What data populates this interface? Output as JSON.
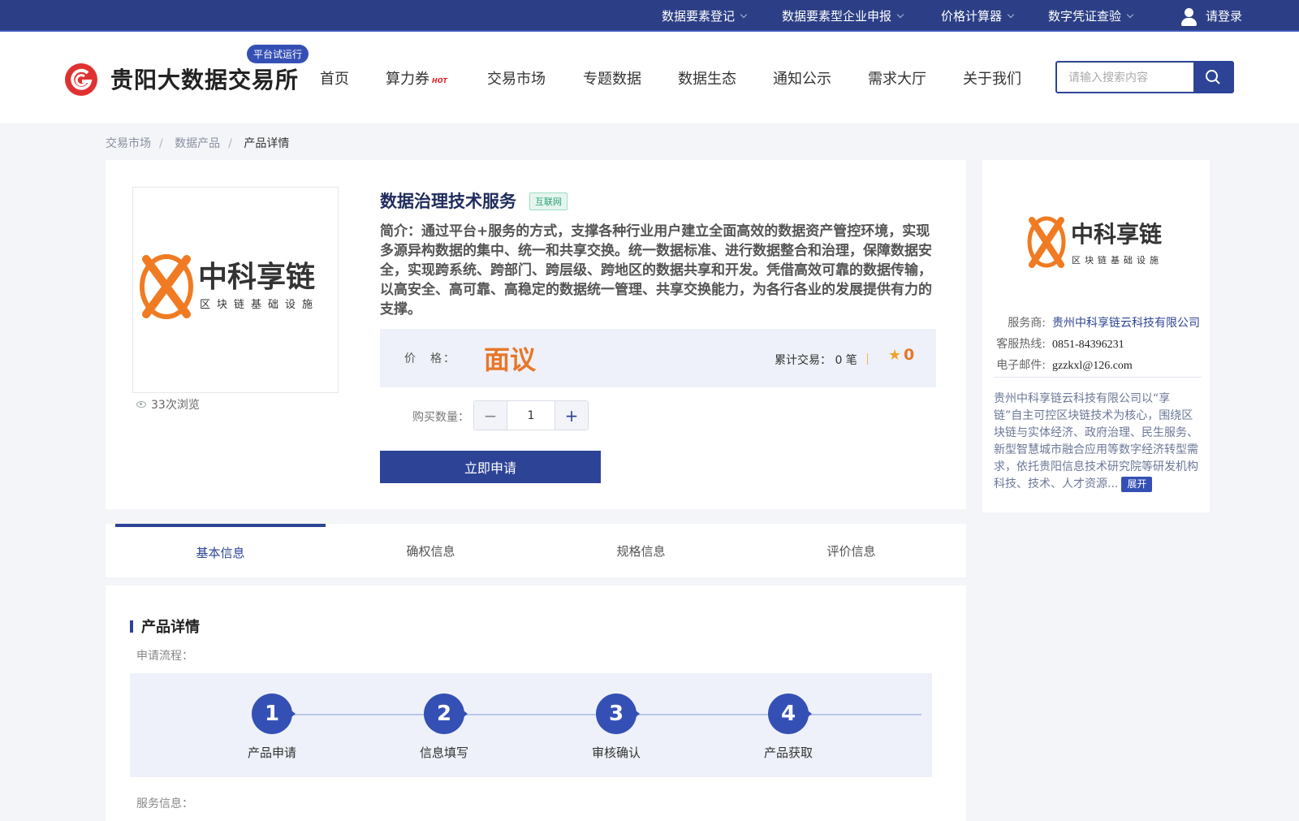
{
  "topbar": {
    "items": [
      "数据要素登记",
      "数据要素型企业申报",
      "价格计算器",
      "数字凭证查验"
    ],
    "login": "请登录"
  },
  "header": {
    "site_name": "贵阳大数据交易所",
    "trial_badge": "平台试运行",
    "nav": [
      "首页",
      "算力券",
      "交易市场",
      "专题数据",
      "数据生态",
      "通知公示",
      "需求大厅",
      "关于我们"
    ],
    "hot_badge": "HOT",
    "search_placeholder": "请输入搜索内容"
  },
  "breadcrumb": [
    "交易市场",
    "数据产品",
    "产品详情"
  ],
  "product": {
    "title": "数据治理技术服务",
    "tag": "互联网",
    "intro": "简介：通过平台+服务的方式，支撑各种行业用户建立全面高效的数据资产管控环境，实现多源异构数据的集中、统一和共享交换。统一数据标准、进行数据整合和治理，保障数据安全，实现跨系统、跨部门、跨层级、跨地区的数据共享和开发。凭借高效可靠的数据传输，以高安全、高可靠、高稳定的数据统一管理、共享交换能力，为各行各业的发展提供有力的支撑。",
    "price_label": "价　格：",
    "price": "面议",
    "deals": "累计交易： 0 笔",
    "rating": "0",
    "views": "33次浏览",
    "qty_label": "购买数量：",
    "qty": "1",
    "apply_button": "立即申请",
    "logo_text": {
      "main": "中科享链",
      "sub": "区块链基础设施"
    }
  },
  "provider": {
    "label_provider": "服务商:",
    "provider": "贵州中科享链云科技有限公司",
    "label_hotline": "客服热线:",
    "hotline": "0851-84396231",
    "label_email": "电子邮件:",
    "email": "gzzkxl@126.com",
    "description": "贵州中科享链云科技有限公司以“享链”自主可控区块链技术为核心，围绕区块链与实体经济、政府治理、民生服务、新型智慧城市融合应用等数字经济转型需求，依托贵阳信息技术研究院等研发机构科技、技术、人才资源...",
    "expand": "展开"
  },
  "tabs": [
    "基本信息",
    "确权信息",
    "规格信息",
    "评价信息"
  ],
  "detail": {
    "title": "产品详情",
    "flow_label": "申请流程：",
    "steps": [
      {
        "num": "1",
        "label": "产品申请"
      },
      {
        "num": "2",
        "label": "信息填写"
      },
      {
        "num": "3",
        "label": "审核确认"
      },
      {
        "num": "4",
        "label": "产品获取"
      }
    ],
    "service_label": "服务信息："
  },
  "colors": {
    "primary": "#2d4496",
    "accent": "#e8772a",
    "logo_red": "#e03131",
    "logo_orange": "#f07b22"
  }
}
